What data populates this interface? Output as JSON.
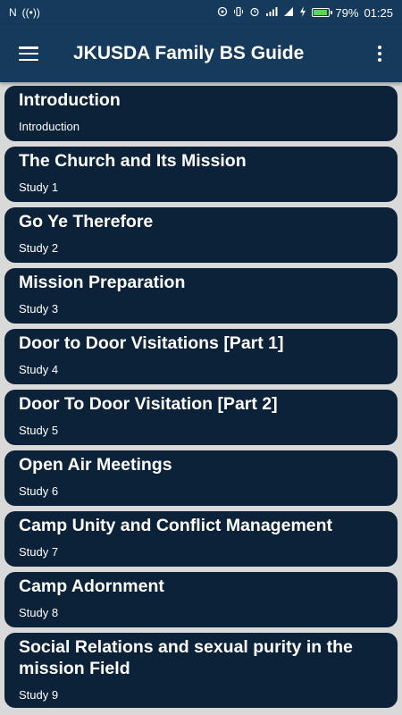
{
  "status_bar": {
    "left_icons": [
      "N",
      "((•))"
    ],
    "battery": "79%",
    "battery_level": 0.79,
    "time": "01:25",
    "colors": {
      "background": "#153a5c",
      "battery_fill": "#5cd45c"
    }
  },
  "app_bar": {
    "title": "JKUSDA Family BS Guide",
    "menu_icon": "hamburger-menu-icon",
    "overflow_icon": "more-vertical-icon"
  },
  "lessons": [
    {
      "title": "Introduction",
      "subtitle": "Introduction"
    },
    {
      "title": "The Church and Its Mission",
      "subtitle": "Study 1"
    },
    {
      "title": "Go Ye Therefore",
      "subtitle": "Study 2"
    },
    {
      "title": "Mission Preparation",
      "subtitle": "Study 3"
    },
    {
      "title": "Door to Door Visitations [Part 1]",
      "subtitle": "Study 4"
    },
    {
      "title": "Door To Door Visitation [Part 2]",
      "subtitle": "Study 5"
    },
    {
      "title": "Open Air Meetings",
      "subtitle": "Study 6"
    },
    {
      "title": "Camp Unity and Conflict Management",
      "subtitle": "Study 7"
    },
    {
      "title": "Camp Adornment",
      "subtitle": "Study 8"
    },
    {
      "title": "Social Relations and sexual purity in the mission Field",
      "subtitle": "Study 9"
    }
  ],
  "colors": {
    "app_bar": "#153a5c",
    "card": "#0c2238",
    "page_background": "#d9d9d9",
    "text": "#ffffff"
  }
}
